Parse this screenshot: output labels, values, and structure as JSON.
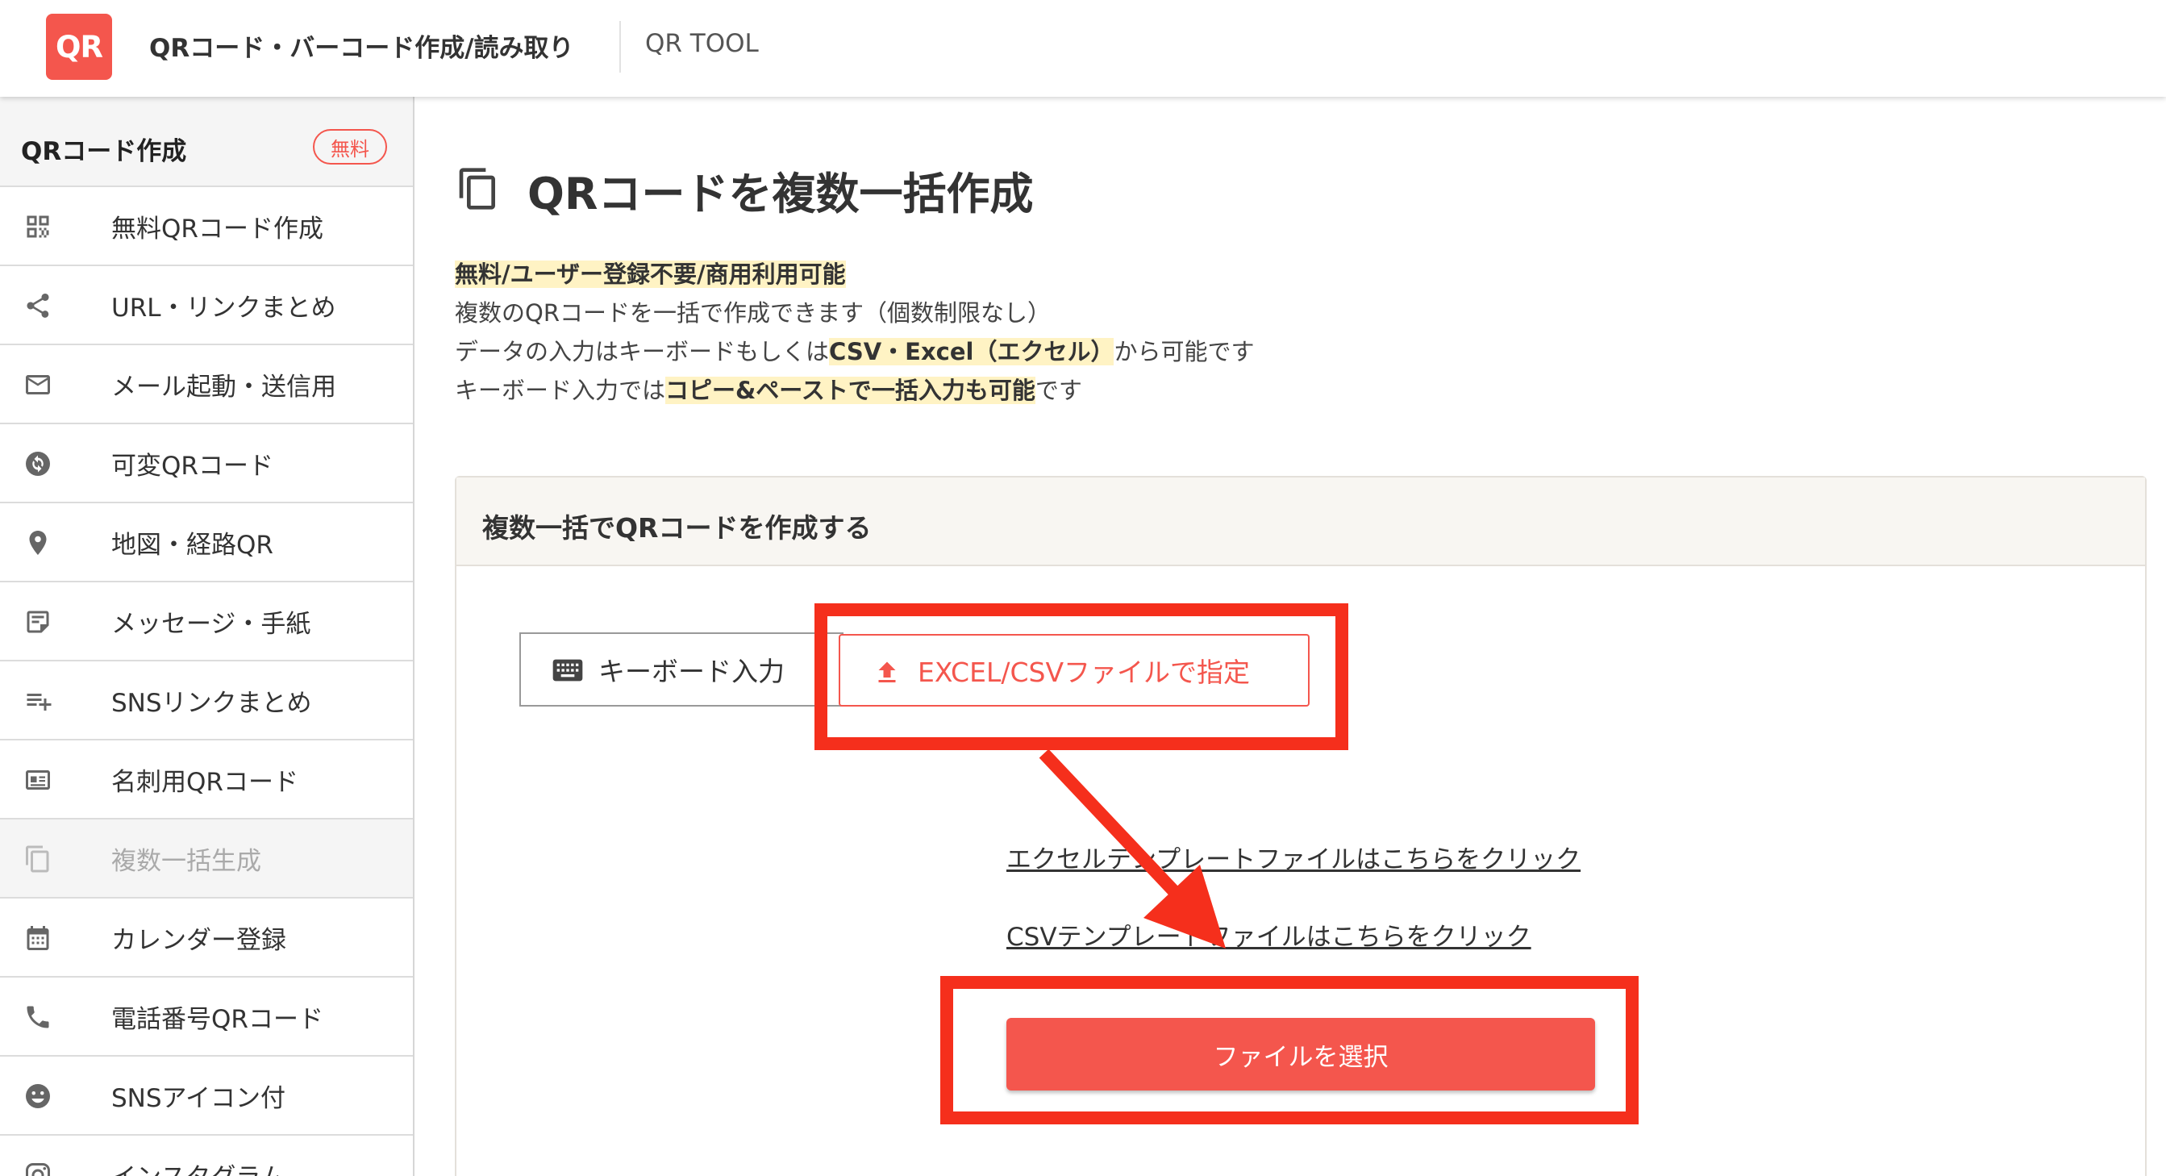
{
  "header": {
    "logo_text": "QR",
    "site_title": "QRコード・バーコード作成/読み取り",
    "sub_title": "QR TOOL"
  },
  "sidebar": {
    "section_title": "QRコード作成",
    "badge": "無料",
    "items": [
      {
        "label": "無料QRコード作成",
        "icon": "qr-code-icon"
      },
      {
        "label": "URL・リンクまとめ",
        "icon": "share-icon"
      },
      {
        "label": "メール起動・送信用",
        "icon": "mail-icon"
      },
      {
        "label": "可変QRコード",
        "icon": "sync-icon"
      },
      {
        "label": "地図・経路QR",
        "icon": "map-pin-icon"
      },
      {
        "label": "メッセージ・手紙",
        "icon": "note-icon"
      },
      {
        "label": "SNSリンクまとめ",
        "icon": "playlist-add-icon"
      },
      {
        "label": "名刺用QRコード",
        "icon": "id-card-icon"
      },
      {
        "label": "複数一括生成",
        "icon": "copy-icon",
        "active": true
      },
      {
        "label": "カレンダー登録",
        "icon": "calendar-icon"
      },
      {
        "label": "電話番号QRコード",
        "icon": "phone-icon"
      },
      {
        "label": "SNSアイコン付",
        "icon": "smiley-icon"
      },
      {
        "label": "インスタグラム",
        "icon": "instagram-icon"
      }
    ]
  },
  "main": {
    "page_title": "QRコードを複数一括作成",
    "desc": {
      "line1_hl": "無料/ユーザー登録不要/商用利用可能",
      "line2": "複数のQRコードを一括で作成できます（個数制限なし）",
      "line3_pre": "データの入力はキーボードもしくは",
      "line3_hl": "CSV・Excel（エクセル）",
      "line3_post": "から可能です",
      "line4_pre": "キーボード入力では",
      "line4_hl": "コピー&ペーストで一括入力も可能",
      "line4_post": "です"
    },
    "panel": {
      "title": "複数一括でQRコードを作成する",
      "tab_keyboard": "キーボード入力",
      "tab_csv": "EXCEL/CSVファイルで指定",
      "link_excel": "エクセルテンプレートファイルはこちらをクリック",
      "link_csv": "CSVテンプレートファイルはこちらをクリック",
      "select_button": "ファイルを選択"
    }
  },
  "colors": {
    "accent": "#f4564d",
    "highlight": "#fff3c4",
    "annotation": "#f52f1c"
  }
}
